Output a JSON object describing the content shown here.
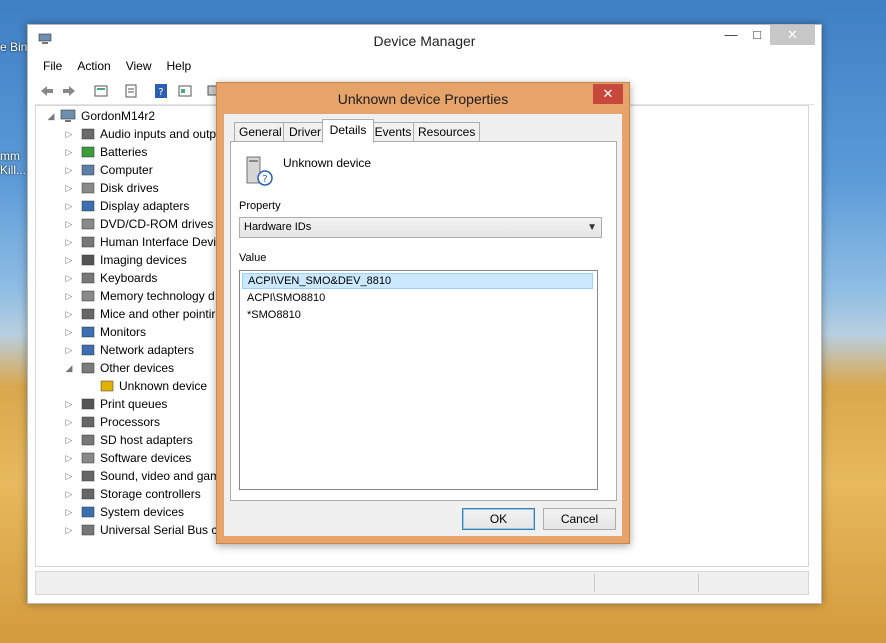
{
  "desktop": {
    "labels": [
      "e Bin",
      "mm",
      "Kill..."
    ]
  },
  "window": {
    "title": "Device Manager",
    "minimize": "—",
    "maximize": "□",
    "close": "✕"
  },
  "menu": [
    "File",
    "Action",
    "View",
    "Help"
  ],
  "tree": {
    "root": "GordonM14r2",
    "items": [
      "Audio inputs and outp",
      "Batteries",
      "Computer",
      "Disk drives",
      "Display adapters",
      "DVD/CD-ROM drives",
      "Human Interface Devic",
      "Imaging devices",
      "Keyboards",
      "Memory technology d",
      "Mice and other pointir",
      "Monitors",
      "Network adapters",
      "Other devices",
      "Unknown device",
      "Print queues",
      "Processors",
      "SD host adapters",
      "Software devices",
      "Sound, video and gam",
      "Storage controllers",
      "System devices",
      "Universal Serial Bus co"
    ]
  },
  "dialog": {
    "title": "Unknown device Properties",
    "close": "✕",
    "tabs": [
      "General",
      "Driver",
      "Details",
      "Events",
      "Resources"
    ],
    "active_tab": "Details",
    "device_name": "Unknown device",
    "property_label": "Property",
    "property_value": "Hardware IDs",
    "value_label": "Value",
    "values": [
      "ACPI\\VEN_SMO&DEV_8810",
      "ACPI\\SMO8810",
      "*SMO8810"
    ],
    "ok": "OK",
    "cancel": "Cancel"
  },
  "colors": {
    "dialog_frame": "#e6a36a",
    "close_red": "#c7493b",
    "selection": "#cce8ff"
  }
}
